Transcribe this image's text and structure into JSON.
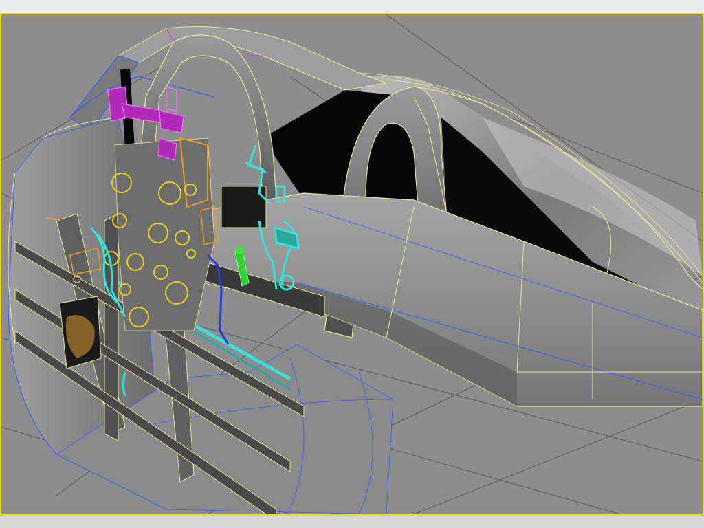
{
  "app": {
    "viewport": {
      "shading_mode": "shaded-with-edged-faces",
      "colors": {
        "active_border": "#f0e000",
        "background": "#8d8d8d",
        "grid_line": "#5a5a5a",
        "surface_light": "#b2b2b2",
        "surface_mid": "#8a8a8a",
        "surface_dark": "#4a4a4a",
        "interior_black": "#050505",
        "wire_yellow": "#e8e49a",
        "wire_blue": "#3b5cff",
        "gauge_yellow": "#e6d21a",
        "pipe_cyan": "#38e0d8",
        "part_magenta": "#d83ae0",
        "lever_green": "#40e040",
        "bracket_orange": "#e89a20"
      },
      "objects": [
        "fuselage-body",
        "canopy-frame",
        "roll-bar",
        "fuselage-side-panel",
        "instrument-panel",
        "gauge-cluster",
        "control-stick",
        "hydraulic-pipes",
        "headrest-bracket",
        "ribbed-wall"
      ]
    }
  }
}
